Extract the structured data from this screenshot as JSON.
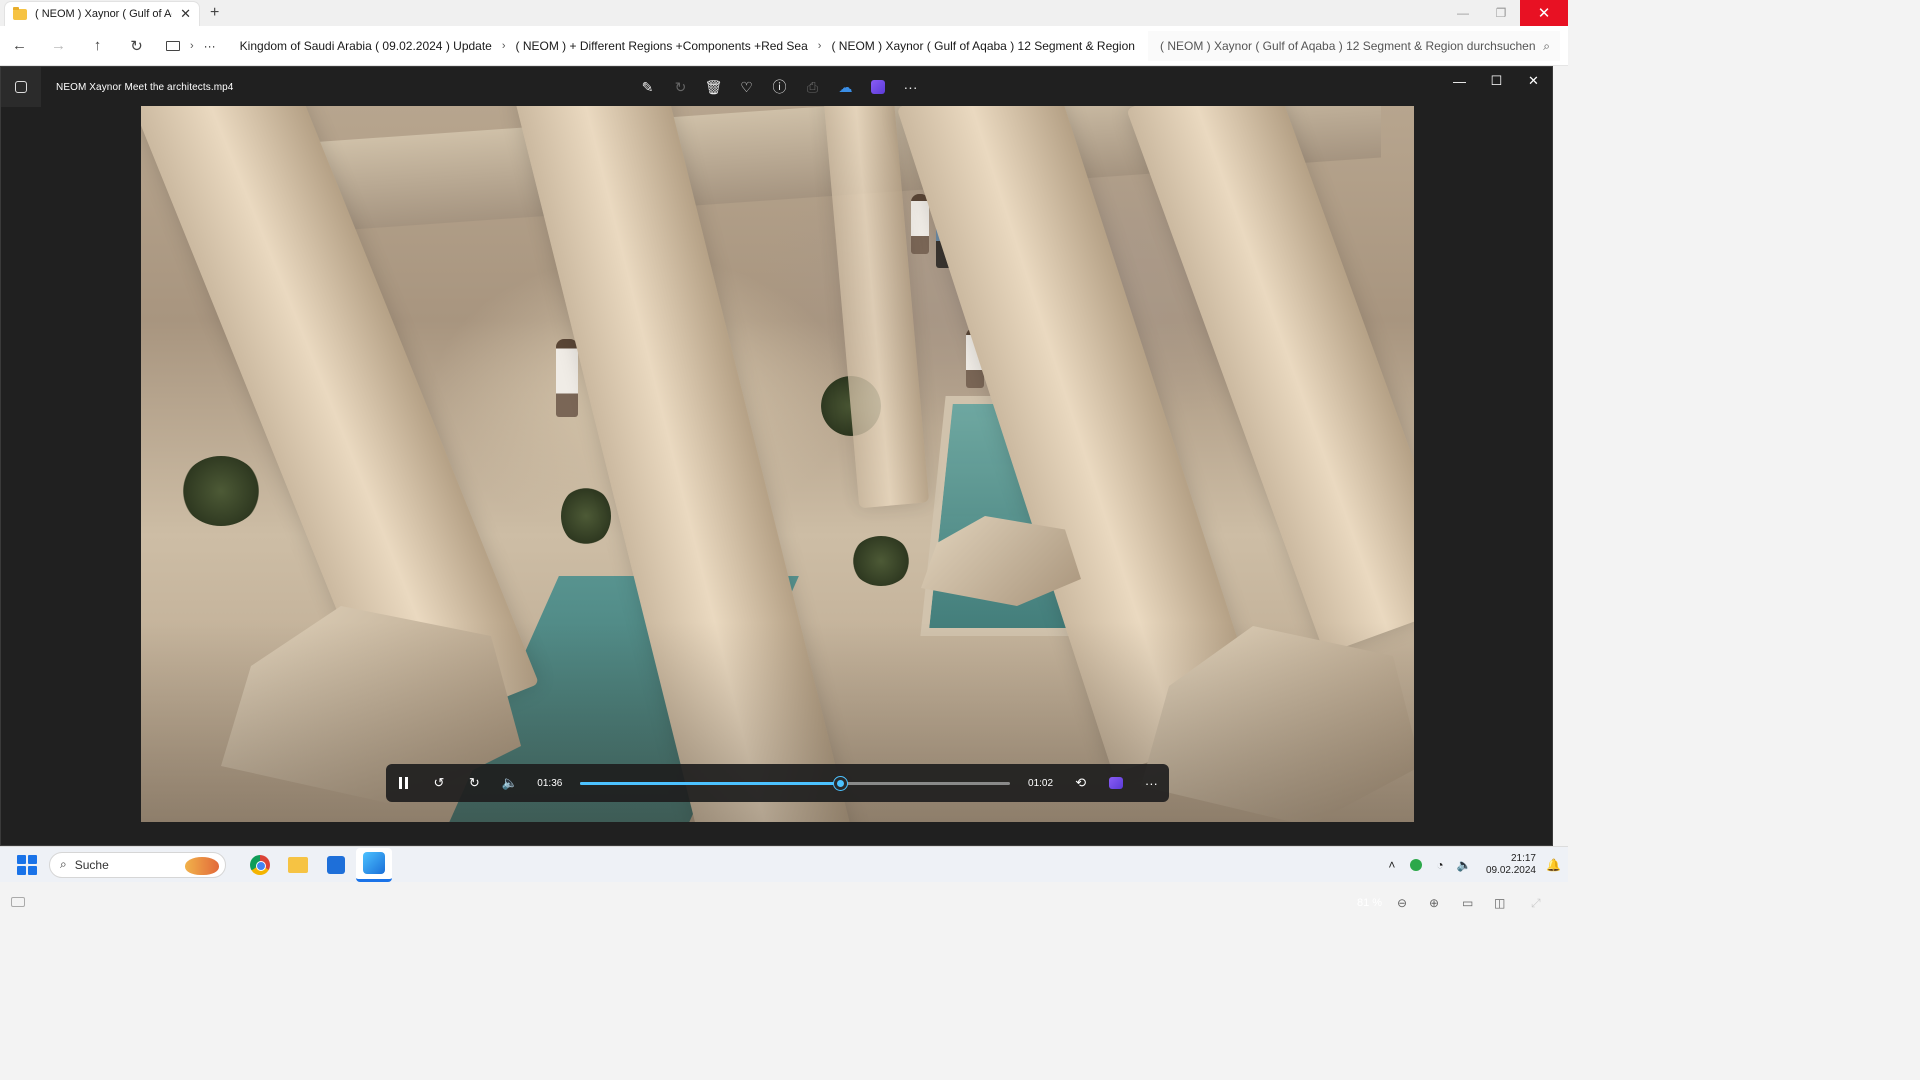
{
  "explorer": {
    "tab_title": "( NEOM ) Xaynor ( Gulf of Aqa",
    "tab_close": "✕",
    "new_tab": "+",
    "window_controls": {
      "minimize": "—",
      "restore": "❐",
      "close": "✕"
    },
    "nav": {
      "back": "←",
      "forward": "→",
      "up": "↑",
      "refresh": "↻",
      "more": "···"
    },
    "breadcrumbs": [
      "Kingdom of Saudi Arabia ( 09.02.2024 ) Update",
      "( NEOM ) + Different Regions +Components +Red Sea",
      "( NEOM ) Xaynor ( Gulf of Aqaba ) 12 Segment & Region"
    ],
    "search_placeholder": "( NEOM ) Xaynor ( Gulf of Aqaba ) 12 Segment & Region durchsuchen"
  },
  "viewer": {
    "file_name": "NEOM  Xaynor  Meet the architects.mp4",
    "toolbar_icons": [
      "edit-icon",
      "rotate-icon",
      "delete-icon",
      "favorite-icon",
      "info-icon",
      "print-icon",
      "onedrive-icon",
      "clipchamp-icon",
      "more-icon"
    ],
    "window_controls": {
      "minimize": "—",
      "maximize": "☐",
      "close": "✕"
    },
    "player": {
      "elapsed": "01:36",
      "remaining": "01:02",
      "progress": 0.605,
      "icons": [
        "pause-icon",
        "rewind-10-icon",
        "forward-30-icon",
        "volume-icon",
        "repeat-off-icon",
        "clipchamp-icon",
        "more-icon"
      ]
    },
    "zoom": "81 %"
  },
  "taskbar": {
    "search_label": "Suche",
    "time": "21:17",
    "date": "09.02.2024"
  },
  "colors": {
    "accent": "#4cc2ff",
    "close_red": "#e81123",
    "viewer_bg": "#202020"
  }
}
